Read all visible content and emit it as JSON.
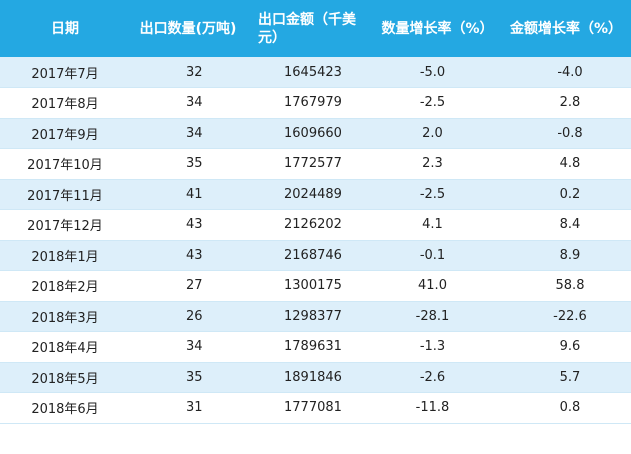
{
  "table": {
    "headers": {
      "date": "日期",
      "quantity": "出口数量(万吨)",
      "amount": "出口金额（千美元）",
      "qty_growth": "数量增长率（%）",
      "amt_growth": "金额增长率（%）"
    },
    "rows": [
      {
        "date": "2017年7月",
        "quantity": "32",
        "amount": "1645423",
        "qty_growth": "-5.0",
        "amt_growth": "-4.0"
      },
      {
        "date": "2017年8月",
        "quantity": "34",
        "amount": "1767979",
        "qty_growth": "-2.5",
        "amt_growth": "2.8"
      },
      {
        "date": "2017年9月",
        "quantity": "34",
        "amount": "1609660",
        "qty_growth": "2.0",
        "amt_growth": "-0.8"
      },
      {
        "date": "2017年10月",
        "quantity": "35",
        "amount": "1772577",
        "qty_growth": "2.3",
        "amt_growth": "4.8"
      },
      {
        "date": "2017年11月",
        "quantity": "41",
        "amount": "2024489",
        "qty_growth": "-2.5",
        "amt_growth": "0.2"
      },
      {
        "date": "2017年12月",
        "quantity": "43",
        "amount": "2126202",
        "qty_growth": "4.1",
        "amt_growth": "8.4"
      },
      {
        "date": "2018年1月",
        "quantity": "43",
        "amount": "2168746",
        "qty_growth": "-0.1",
        "amt_growth": "8.9"
      },
      {
        "date": "2018年2月",
        "quantity": "27",
        "amount": "1300175",
        "qty_growth": "41.0",
        "amt_growth": "58.8"
      },
      {
        "date": "2018年3月",
        "quantity": "26",
        "amount": "1298377",
        "qty_growth": "-28.1",
        "amt_growth": "-22.6"
      },
      {
        "date": "2018年4月",
        "quantity": "34",
        "amount": "1789631",
        "qty_growth": "-1.3",
        "amt_growth": "9.6"
      },
      {
        "date": "2018年5月",
        "quantity": "35",
        "amount": "1891846",
        "qty_growth": "-2.6",
        "amt_growth": "5.7"
      },
      {
        "date": "2018年6月",
        "quantity": "31",
        "amount": "1777081",
        "qty_growth": "-11.8",
        "amt_growth": "0.8"
      }
    ]
  },
  "colors": {
    "header_bg": "#24a8e2",
    "row_alt_bg": "#ddeffa"
  }
}
